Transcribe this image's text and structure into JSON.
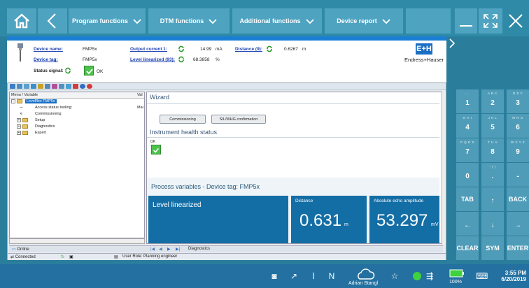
{
  "nav": {
    "program_functions": "Program functions",
    "dtm_functions": "DTM functions",
    "additional_functions": "Additional functions",
    "device_report": "Device report"
  },
  "device": {
    "device_name_label": "Device name:",
    "device_name_value": "FMP5x",
    "device_tag_label": "Device tag:",
    "device_tag_value": "FMP5x",
    "status_signal_label": "Status signal:",
    "status_signal_value": "OK",
    "output_current_label": "Output current 1:",
    "output_current_value": "14.99",
    "output_current_unit": "mA",
    "level_linearized_label": "Level linearized (93):",
    "level_linearized_value": "68.3858",
    "level_linearized_unit": "%",
    "distance_label": "Distance (9):",
    "distance_value": "0.6267",
    "distance_unit": "m",
    "logo_text": "Endress+Hauser",
    "logo_box": "E+H"
  },
  "tree": {
    "col_variable": "Menu / Variable",
    "col_value": "Val",
    "items": [
      {
        "label": "Levelflex FMP5x",
        "value": ""
      },
      {
        "label": "Access status tooling:",
        "value": "Mai"
      },
      {
        "label": "Commissioning",
        "value": ""
      },
      {
        "label": "Setup",
        "value": ""
      },
      {
        "label": "Diagnostics",
        "value": ""
      },
      {
        "label": "Expert",
        "value": ""
      }
    ]
  },
  "wizard": {
    "title": "Wizard",
    "btn_commissioning": "Commissioning",
    "btn_sil": "SIL/WHG confirmation",
    "health_title": "Instrument health status",
    "health_value": "OK"
  },
  "process": {
    "title": "Process variables - Device tag: FMP5x",
    "tile1_label": "Level linearized",
    "tile2_label": "Distance",
    "tile2_value": "0.631",
    "tile2_unit": "m",
    "tile3_label": "Absolute echo amplitude",
    "tile3_value": "53.297",
    "tile3_unit": "mV"
  },
  "bottom": {
    "tab_diagnostics": "Diagnostics",
    "tab_online": "Online",
    "status_connected": "Connected",
    "user_role": "User Role: Planning engineer"
  },
  "keypad": {
    "keys": [
      {
        "sub": "- .",
        "main": "1"
      },
      {
        "sub": "A B C",
        "main": "2"
      },
      {
        "sub": "D E F",
        "main": "3"
      },
      {
        "sub": "G H I",
        "main": "4"
      },
      {
        "sub": "J K L",
        "main": "5"
      },
      {
        "sub": "M N O",
        "main": "6"
      },
      {
        "sub": "P Q R S",
        "main": "7"
      },
      {
        "sub": "T U V",
        "main": "8"
      },
      {
        "sub": "W X Y Z",
        "main": "9"
      },
      {
        "sub": "",
        "main": "0"
      },
      {
        "sub": "- ( )",
        "main": "."
      },
      {
        "sub": "",
        "main": "-"
      },
      {
        "sub": "",
        "main": "TAB"
      },
      {
        "sub": "",
        "main": "↑"
      },
      {
        "sub": "",
        "main": "BACK"
      },
      {
        "sub": "",
        "main": "←"
      },
      {
        "sub": "",
        "main": "↓"
      },
      {
        "sub": "",
        "main": "→"
      },
      {
        "sub": "",
        "main": "CLEAR"
      },
      {
        "sub": "",
        "main": "SYM"
      },
      {
        "sub": "",
        "main": "ENTER"
      }
    ]
  },
  "taskbar": {
    "user": "Adrian Stangl",
    "battery": "100%",
    "time": "3:55 PM",
    "date": "6/20/2019"
  },
  "colors": {
    "accent": "#2f8aa8",
    "tile": "#136ea6",
    "status_ok": "#4cc24c"
  }
}
